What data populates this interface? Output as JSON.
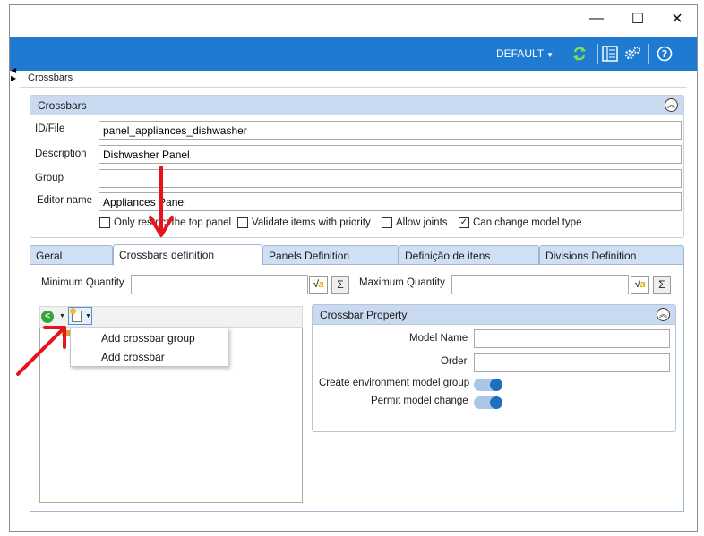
{
  "window": {
    "controls": {
      "minimize": "—",
      "maximize": "☐",
      "close": "✕"
    }
  },
  "topbar": {
    "profile": "DEFAULT",
    "icons": [
      "refresh-icon",
      "panel-layout-icon",
      "settings-gears-icon",
      "help-icon"
    ],
    "accent_color": "#1e7bd1"
  },
  "breadcrumb": "Crossbars",
  "crossbars_group": {
    "title": "Crossbars",
    "fields": {
      "id_file": {
        "label": "ID/File",
        "value": "panel_appliances_dishwasher"
      },
      "description": {
        "label": "Description",
        "value": "Dishwasher Panel"
      },
      "group": {
        "label": "Group",
        "value": ""
      },
      "editor_name": {
        "label": "Editor name",
        "value": "Appliances Panel"
      }
    },
    "checkboxes": [
      {
        "label": "Only restrict the top panel",
        "checked": false
      },
      {
        "label": "Validate items with priority",
        "checked": false
      },
      {
        "label": "Allow joints",
        "checked": false
      },
      {
        "label": "Can change model type",
        "checked": true
      }
    ]
  },
  "tabs": [
    {
      "label": "Geral",
      "active": false
    },
    {
      "label": "Crossbars definition",
      "active": true
    },
    {
      "label": "Panels Definition",
      "active": false
    },
    {
      "label": "Definição de itens",
      "active": false
    },
    {
      "label": "Divisions Definition",
      "active": false
    }
  ],
  "crossbars_definition": {
    "minimum_quantity": {
      "label": "Minimum Quantity",
      "value": ""
    },
    "maximum_quantity": {
      "label": "Maximum Quantity",
      "value": ""
    },
    "sigma_label": "Σ",
    "new_menu": {
      "items": [
        "Add crossbar group",
        "Add crossbar"
      ]
    }
  },
  "crossbar_property": {
    "title": "Crossbar Property",
    "model_name": {
      "label": "Model Name",
      "value": ""
    },
    "order": {
      "label": "Order",
      "value": ""
    },
    "create_env_group": {
      "label": "Create environment model group",
      "on": true
    },
    "permit_model_change": {
      "label": "Permit model change",
      "on": true
    }
  },
  "annotation_color": "#e8141c"
}
